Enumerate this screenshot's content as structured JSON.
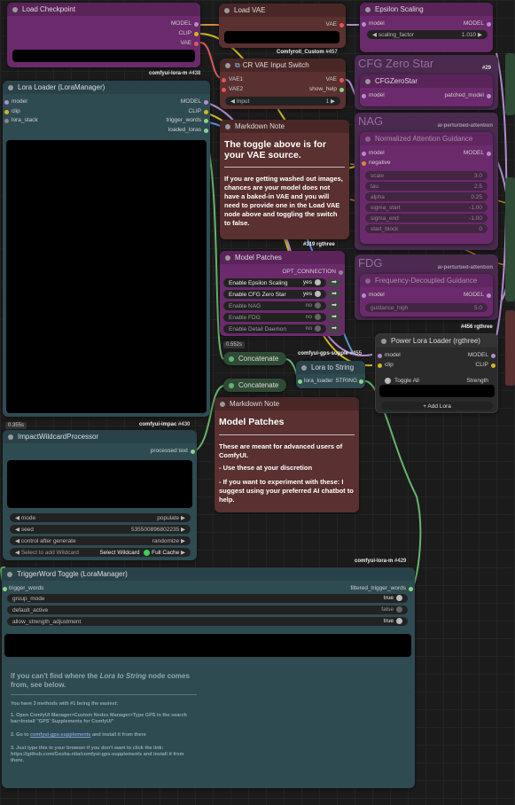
{
  "colors": {
    "purple": "#6b2a6b",
    "teal": "#2f4b52",
    "brown": "#5a3030",
    "green": "#2f4a35",
    "yellow": "#d2b623",
    "blue": "#5b8dd8"
  },
  "load_checkpoint": {
    "title": "Load Checkpoint",
    "outputs": [
      "MODEL",
      "CLIP",
      "VAE"
    ],
    "badge": "comfyui-lora-m",
    "id": "#438"
  },
  "load_vae": {
    "title": "Load VAE",
    "output": "VAE",
    "badge": "Comfyroll_Custom",
    "id": "#457"
  },
  "epsilon": {
    "title": "Epsilon Scaling",
    "input": "model",
    "output": "MODEL",
    "widget_label": "scaling_factor",
    "widget_value": "1.010"
  },
  "cr_switch": {
    "title": "CR VAE Input Switch",
    "inputs": [
      "VAE1",
      "VAE2"
    ],
    "outputs": [
      "VAE",
      "show_help"
    ],
    "widget_label": "Input",
    "widget_value": "1"
  },
  "cfg_zero": {
    "big": "CFG Zero Star",
    "title": "CFGZeroStar",
    "input": "model",
    "output": "patched_model",
    "id": "#29"
  },
  "nag": {
    "big": "NAG",
    "badge": "ai-perturbed-attention",
    "title": "Normalized Attention Guidance",
    "inputs": [
      "model",
      "negative"
    ],
    "output": "MODEL",
    "widgets": [
      [
        "scale",
        "3.0"
      ],
      [
        "tau",
        "2.5"
      ],
      [
        "alpha",
        "0.25"
      ],
      [
        "sigma_start",
        "-1.00"
      ],
      [
        "sigma_end",
        "-1.00"
      ],
      [
        "start_block",
        "0"
      ]
    ]
  },
  "fdg": {
    "big": "FDG",
    "badge": "ai-perturbed-attention",
    "title": "Frequency-Decoupled Guidance",
    "input": "model",
    "output": "MODEL",
    "widget": [
      "guidance_high",
      "5.0"
    ],
    "id": "#456 rgthree"
  },
  "lora_loader": {
    "title": "Lora Loader (LoraManager)",
    "inputs": [
      "model",
      "clip",
      "lora_stack"
    ],
    "outputs": [
      "MODEL",
      "CLIP",
      "trigger_words",
      "loaded_loras"
    ],
    "time": "0.355s",
    "badge": "comfyui-impac",
    "id": "#430"
  },
  "md1": {
    "title": "Markdown Note",
    "heading": "The toggle above is for your VAE source.",
    "body": "If you are getting washed out images, chances are your model does not have a baked-in VAE and you will need to provide one in the Load VAE node above and toggling the switch to false.",
    "id": "#319 rgthree"
  },
  "patches": {
    "title": "Model Patches",
    "output": "OPT_CONNECTION",
    "rows": [
      [
        "Enable Epsilon Scaling",
        "yes"
      ],
      [
        "Enable CFG Zero Star",
        "yes"
      ],
      [
        "Enable NAG",
        "no"
      ],
      [
        "Enable FDG",
        "no"
      ],
      [
        "Enable Detail Daemon",
        "no"
      ]
    ],
    "time": "0.552s"
  },
  "concat1": {
    "title": "Concatenate",
    "badge": "comfyui-gps-supple",
    "id": "#455"
  },
  "concat2": {
    "title": "Concatenate"
  },
  "lora_to_string": {
    "title": "Lora to String",
    "input": "lora_loader",
    "output": "STRING"
  },
  "power_lora": {
    "title": "Power Lora Loader (rgthree)",
    "inputs": [
      "model",
      "clip"
    ],
    "outputs": [
      "MODEL",
      "CLIP"
    ],
    "toggle_label": "Toggle All",
    "strength_label": "Strength",
    "add_label": "+ Add Lora"
  },
  "md2": {
    "title": "Markdown Note",
    "heading": "Model Patches",
    "p1": "These are meant for advanced users of ComfyUI.",
    "p2": "- Use these at your discretion",
    "p3": "- If you want to experiment with these: I suggest using your preferred AI chatbot to help."
  },
  "wildcard": {
    "title": "ImpactWildcardProcessor",
    "output": "processed text",
    "widgets": [
      [
        "mode",
        "populate"
      ],
      [
        "seed",
        "535500896802235"
      ],
      [
        "control after generate",
        "randomize"
      ]
    ],
    "select_label": "Select to add Wildcard",
    "select_value": "Select Wildcard",
    "full_cache": "Full Cache",
    "badge": "comfyui-lora-m",
    "id": "#429"
  },
  "trigger": {
    "title": "TriggerWord Toggle (LoraManager)",
    "input": "trigger_words",
    "output": "filtered_trigger_words",
    "widgets": [
      [
        "group_mode",
        "true"
      ],
      [
        "default_active",
        "false"
      ],
      [
        "allow_strength_adjustment",
        "true"
      ]
    ],
    "note_heading_a": "If you can't find where the ",
    "note_heading_b": "Lora to String",
    "note_heading_c": " node comes from, see below.",
    "note_intro": "You have 3 methods with #1 being the easiest:",
    "note_1": "1. Open ComfyUI Manager>Custom Nodes Manager>Type GPS in the search bar>Install \"GPS' Supplements for ComfyUI\"",
    "note_2a": "2. Go to ",
    "note_2link": "comfyui-gps-supplements",
    "note_2b": " and install it from there",
    "note_3": "3. Just type this in your browser if you don't want to click the link: https://github.com/Gosha-nita/comfyui-gps-supplements and install it from there."
  }
}
